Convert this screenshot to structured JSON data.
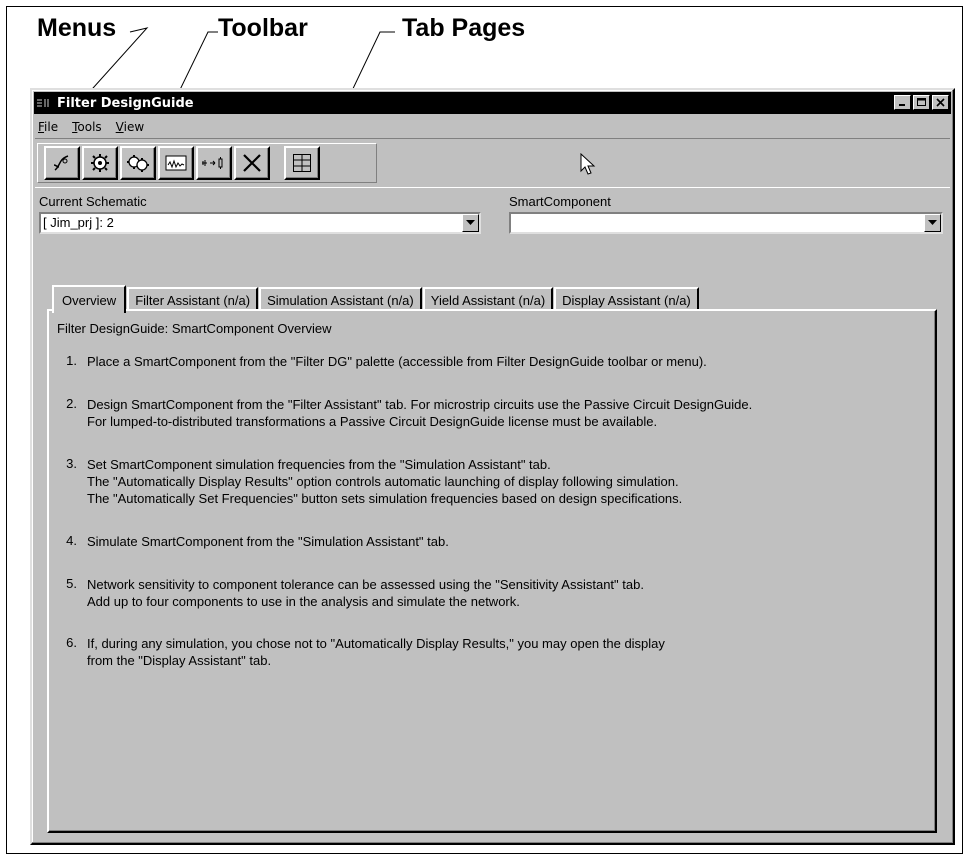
{
  "callouts": {
    "menus": "Menus",
    "toolbar": "Toolbar",
    "tab_pages": "Tab Pages"
  },
  "window": {
    "title": "Filter DesignGuide",
    "title_buttons": [
      "minimize-icon",
      "maximize-icon",
      "close-icon"
    ]
  },
  "menu": {
    "file": "File",
    "tools": "Tools",
    "view": "View"
  },
  "toolbar": {
    "icons": [
      "filter-design-icon",
      "gear-icon",
      "double-gear-icon",
      "display-plot-icon",
      "transform-icon",
      "delete-icon",
      "grid-icon"
    ]
  },
  "schematic": {
    "label": "Current Schematic",
    "value": "[ Jim_prj ]: 2"
  },
  "smartcomponent": {
    "label": "SmartComponent",
    "value": ""
  },
  "tabs": [
    {
      "label": "Overview"
    },
    {
      "label": "Filter Assistant (n/a)"
    },
    {
      "label": "Simulation Assistant (n/a)"
    },
    {
      "label": "Yield Assistant (n/a)"
    },
    {
      "label": "Display Assistant (n/a)"
    }
  ],
  "overview": {
    "title": "Filter DesignGuide: SmartComponent Overview",
    "steps": [
      {
        "num": "1.",
        "lines": [
          "Place a SmartComponent from the \"Filter DG\" palette (accessible from Filter DesignGuide toolbar or menu)."
        ]
      },
      {
        "num": "2.",
        "lines": [
          "Design SmartComponent from the \"Filter Assistant\" tab. For microstrip circuits use the Passive Circuit DesignGuide.",
          "For lumped-to-distributed transformations a Passive Circuit DesignGuide license must be available."
        ]
      },
      {
        "num": "3.",
        "lines": [
          "Set SmartComponent simulation frequencies from the \"Simulation Assistant\" tab.",
          "The \"Automatically Display Results\" option controls automatic launching of display following simulation.",
          "The \"Automatically Set Frequencies\" button sets simulation frequencies based on design specifications."
        ]
      },
      {
        "num": "4.",
        "lines": [
          "Simulate SmartComponent from the \"Simulation Assistant\" tab."
        ]
      },
      {
        "num": "5.",
        "lines": [
          "Network sensitivity to component tolerance can be assessed using the \"Sensitivity Assistant\" tab.",
          "Add up to four components to use in the analysis and simulate the network."
        ]
      },
      {
        "num": "6.",
        "lines": [
          "If, during any simulation, you chose not to \"Automatically Display Results,\" you may open the display",
          "from the \"Display Assistant\" tab."
        ]
      }
    ]
  }
}
